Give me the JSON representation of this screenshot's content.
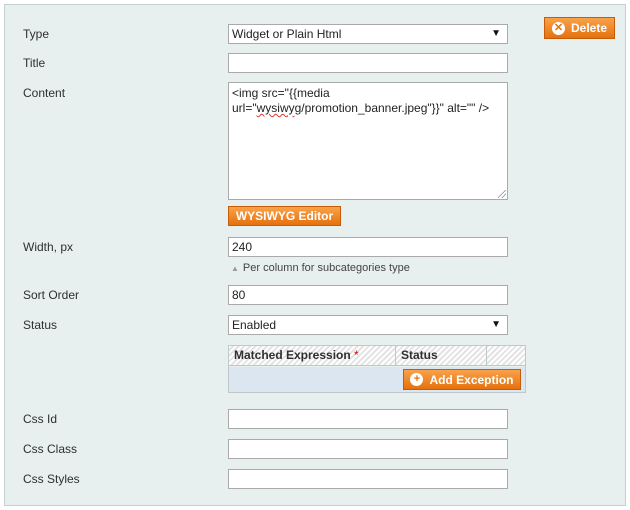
{
  "form": {
    "type": {
      "label": "Type",
      "value": "Widget or Plain Html"
    },
    "title": {
      "label": "Title",
      "value": ""
    },
    "content": {
      "label": "Content",
      "line1": "<img src=\"{{media",
      "line2_pre": "url=\"",
      "line2_err": "wysiwyg",
      "line2_post": "/promotion_banner.jpeg\"}}\" alt=\"\" />"
    },
    "wysiwyg_button": "WYSIWYG Editor",
    "width": {
      "label": "Width, px",
      "value": "240",
      "note": "Per column for subcategories type"
    },
    "sort_order": {
      "label": "Sort Order",
      "value": "80"
    },
    "status": {
      "label": "Status",
      "value": "Enabled"
    },
    "exceptions": {
      "columns": [
        "Matched Expression",
        "Status"
      ],
      "required_mark": "*",
      "add_button": "Add Exception"
    },
    "css_id": {
      "label": "Css Id",
      "value": ""
    },
    "css_class": {
      "label": "Css Class",
      "value": ""
    },
    "css_styles": {
      "label": "Css Styles",
      "value": ""
    }
  },
  "delete_button": "Delete",
  "colors": {
    "accent": "#e6710e",
    "panel": "#e7efef",
    "grid_body": "#dbe6f1"
  }
}
